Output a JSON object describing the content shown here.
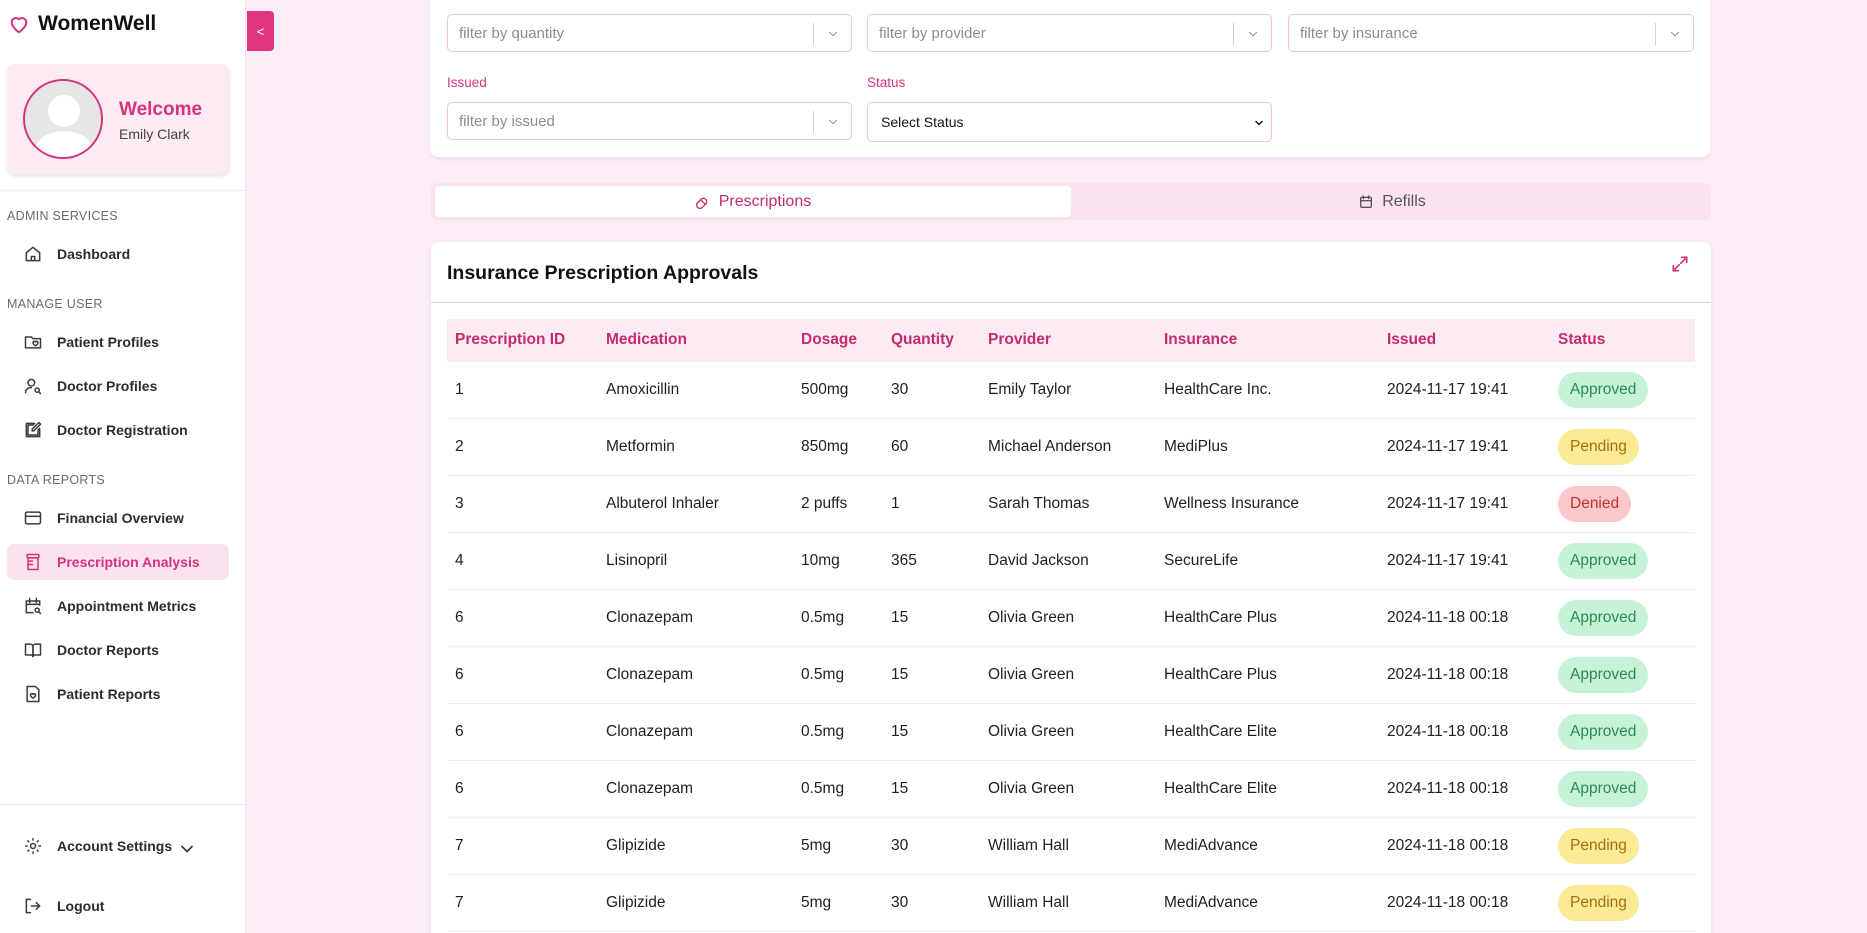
{
  "app": {
    "name": "WomenWell"
  },
  "colors": {
    "accent": "#d6337a",
    "approved": "#c6f3d7",
    "pending": "#fbeb95",
    "denied": "#f9c8cb"
  },
  "profile": {
    "welcome": "Welcome",
    "name": "Emily Clark"
  },
  "sidebar": {
    "sections": [
      {
        "label": "ADMIN SERVICES",
        "items": [
          {
            "label": "Dashboard",
            "icon": "home-icon"
          }
        ]
      },
      {
        "label": "MANAGE USER",
        "items": [
          {
            "label": "Patient Profiles",
            "icon": "folder-heart-icon"
          },
          {
            "label": "Doctor Profiles",
            "icon": "user-search-icon"
          },
          {
            "label": "Doctor Registration",
            "icon": "edit-icon"
          }
        ]
      },
      {
        "label": "DATA REPORTS",
        "items": [
          {
            "label": "Financial Overview",
            "icon": "credit-card-icon"
          },
          {
            "label": "Prescription Analysis",
            "icon": "pill-bottle-icon",
            "active": true
          },
          {
            "label": "Appointment Metrics",
            "icon": "calendar-search-icon"
          },
          {
            "label": "Doctor Reports",
            "icon": "book-icon"
          },
          {
            "label": "Patient Reports",
            "icon": "file-heart-icon"
          }
        ]
      }
    ],
    "account_settings": "Account Settings",
    "logout": "Logout",
    "collapse_label": "<"
  },
  "filters": {
    "quantity_placeholder": "filter by quantity",
    "provider_placeholder": "filter by provider",
    "insurance_placeholder": "filter by insurance",
    "issued_label": "Issued",
    "issued_placeholder": "filter by issued",
    "status_label": "Status",
    "status_value": "Select Status"
  },
  "tabs": {
    "prescriptions": "Prescriptions",
    "refills": "Refills"
  },
  "table": {
    "title": "Insurance Prescription Approvals",
    "columns": [
      "Prescription ID",
      "Medication",
      "Dosage",
      "Quantity",
      "Provider",
      "Insurance",
      "Issued",
      "Status"
    ],
    "rows": [
      [
        "1",
        "Amoxicillin",
        "500mg",
        "30",
        "Emily Taylor",
        "HealthCare Inc.",
        "2024-11-17 19:41",
        "Approved"
      ],
      [
        "2",
        "Metformin",
        "850mg",
        "60",
        "Michael Anderson",
        "MediPlus",
        "2024-11-17 19:41",
        "Pending"
      ],
      [
        "3",
        "Albuterol Inhaler",
        "2 puffs",
        "1",
        "Sarah Thomas",
        "Wellness Insurance",
        "2024-11-17 19:41",
        "Denied"
      ],
      [
        "4",
        "Lisinopril",
        "10mg",
        "365",
        "David Jackson",
        "SecureLife",
        "2024-11-17 19:41",
        "Approved"
      ],
      [
        "6",
        "Clonazepam",
        "0.5mg",
        "15",
        "Olivia Green",
        "HealthCare Plus",
        "2024-11-18 00:18",
        "Approved"
      ],
      [
        "6",
        "Clonazepam",
        "0.5mg",
        "15",
        "Olivia Green",
        "HealthCare Plus",
        "2024-11-18 00:18",
        "Approved"
      ],
      [
        "6",
        "Clonazepam",
        "0.5mg",
        "15",
        "Olivia Green",
        "HealthCare Elite",
        "2024-11-18 00:18",
        "Approved"
      ],
      [
        "6",
        "Clonazepam",
        "0.5mg",
        "15",
        "Olivia Green",
        "HealthCare Elite",
        "2024-11-18 00:18",
        "Approved"
      ],
      [
        "7",
        "Glipizide",
        "5mg",
        "30",
        "William Hall",
        "MediAdvance",
        "2024-11-18 00:18",
        "Pending"
      ],
      [
        "7",
        "Glipizide",
        "5mg",
        "30",
        "William Hall",
        "MediAdvance",
        "2024-11-18 00:18",
        "Pending"
      ]
    ]
  }
}
